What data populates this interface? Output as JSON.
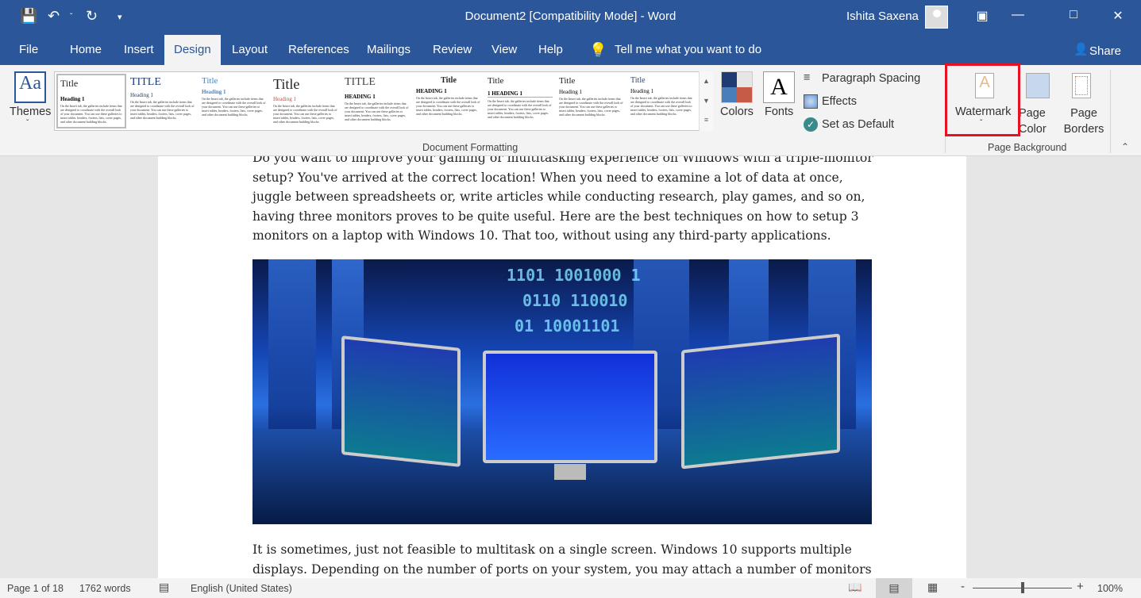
{
  "window": {
    "title": "Document2 [Compatibility Mode]  -  Word",
    "user": "Ishita Saxena"
  },
  "tabs": [
    "File",
    "Home",
    "Insert",
    "Design",
    "Layout",
    "References",
    "Mailings",
    "Review",
    "View",
    "Help"
  ],
  "active_tab": "Design",
  "tell_me": "Tell me what you want to do",
  "share": "Share",
  "ribbon": {
    "themes": "Themes",
    "styles": [
      {
        "title": "Title",
        "heading": "Heading 1"
      },
      {
        "title": "TITLE",
        "heading": "Heading 1"
      },
      {
        "title": "Title",
        "heading": "Heading 1"
      },
      {
        "title": "Title",
        "heading": "Heading 1"
      },
      {
        "title": "TITLE",
        "heading": "HEADING 1"
      },
      {
        "title": "Title",
        "heading": "HEADING 1"
      },
      {
        "title": "Title",
        "heading": "1  HEADING 1"
      },
      {
        "title": "Title",
        "heading": "Heading 1"
      },
      {
        "title": "Title",
        "heading": "Heading 1"
      }
    ],
    "style_body": "On the Insert tab, the galleries include items that are designed to coordinate with the overall look of your document. You can use these galleries to insert tables, headers, footers, lists, cover pages, and other document building blocks.",
    "colors": "Colors",
    "fonts": "Fonts",
    "paragraph_spacing": "Paragraph Spacing",
    "effects": "Effects",
    "set_default": "Set as Default",
    "document_formatting": "Document Formatting",
    "watermark": "Watermark",
    "page_color": "Page Color",
    "page_borders": "Page Borders",
    "page_background": "Page Background",
    "highlight_color": "#e81123"
  },
  "document": {
    "para1": "Do you want to improve your gaming or multitasking experience on Windows with a triple-monitor setup? You've arrived at the correct location! When you need to examine a lot of data at once, juggle between spreadsheets or, write articles while conducting research, play games, and so on, having three monitors proves to be quite useful. Here are the best techniques on how to setup 3 monitors on a laptop with Windows 10. That too, without using any third-party applications.",
    "image_binary": [
      "1101 1001000 1",
      "0110 110010",
      "01 10001101"
    ],
    "para2": "It is sometimes, just not feasible to multitask on a single screen. Windows 10 supports multiple displays. Depending on the number of ports on your system, you may attach a number of monitors"
  },
  "status": {
    "page": "Page 1 of 18",
    "words": "1762 words",
    "language": "English (United States)",
    "zoom": "100%",
    "zoom_level": 100
  }
}
